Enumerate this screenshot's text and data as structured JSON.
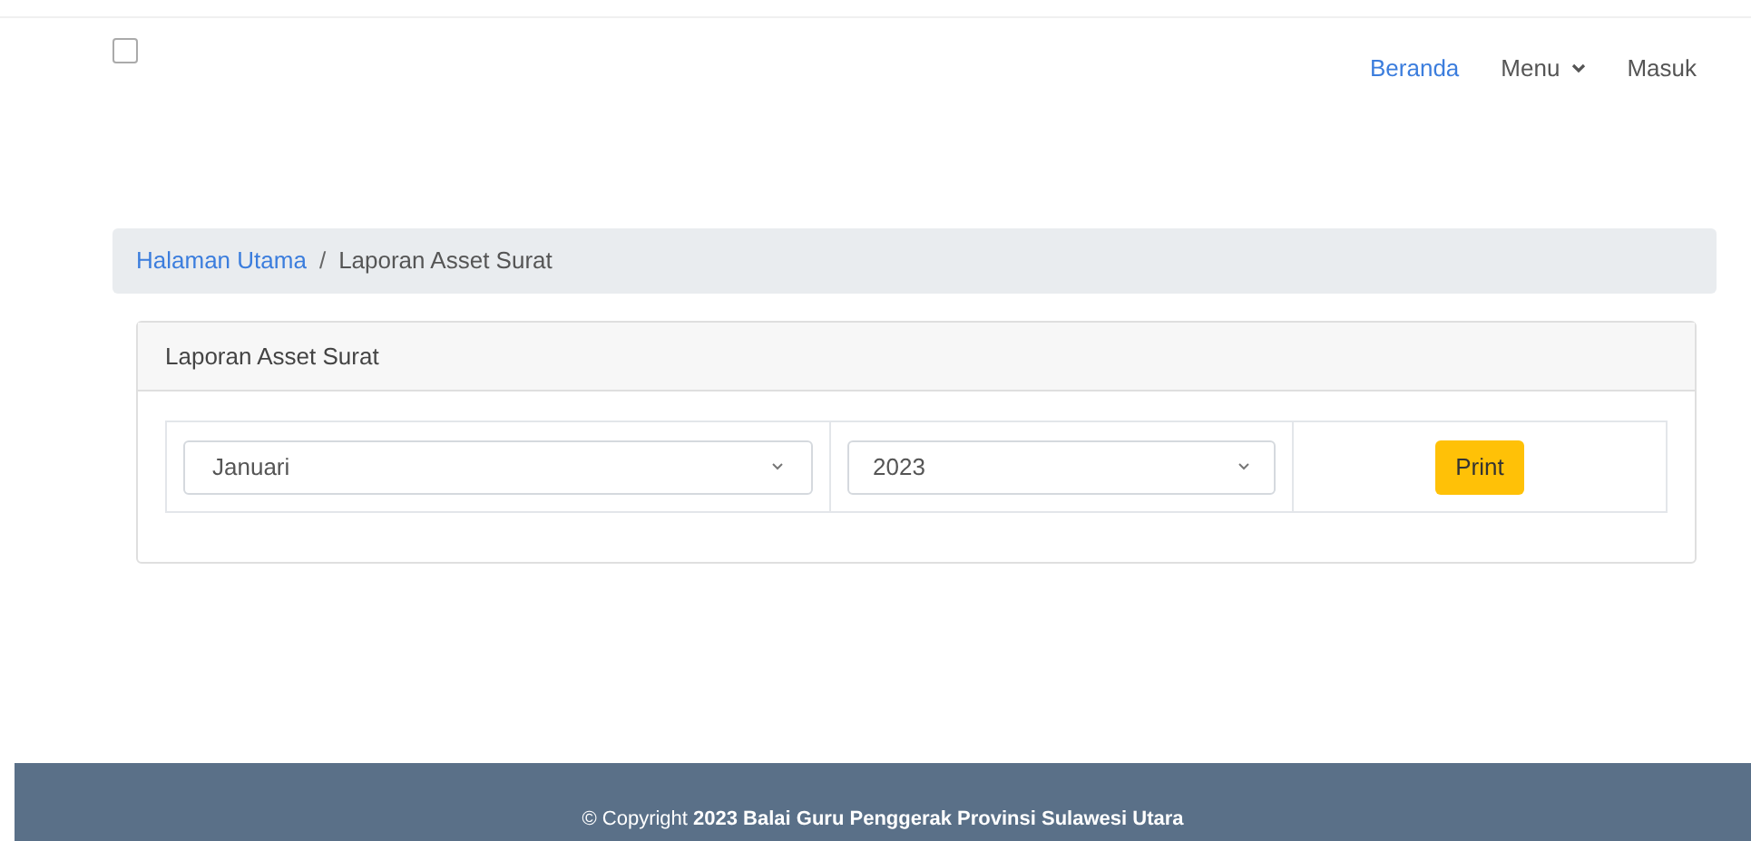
{
  "navbar": {
    "items": [
      {
        "label": "Beranda",
        "selected": true,
        "dropdown": false
      },
      {
        "label": "Menu",
        "selected": false,
        "dropdown": true
      },
      {
        "label": "Masuk",
        "selected": false,
        "dropdown": false
      }
    ]
  },
  "breadcrumb_separator": "/",
  "breadcrumb": [
    {
      "label": "Halaman Utama",
      "kind": "link"
    },
    {
      "label": "Laporan Asset Surat",
      "kind": "current"
    }
  ],
  "card": {
    "title": "Laporan Asset Surat",
    "month_select": {
      "value": "Januari"
    },
    "year_select": {
      "value": "2023"
    },
    "print_button": "Print"
  },
  "footer": {
    "text": "© Copyright **2023 Balai Guru Penggerak Provinsi Sulawesi Utara**"
  }
}
